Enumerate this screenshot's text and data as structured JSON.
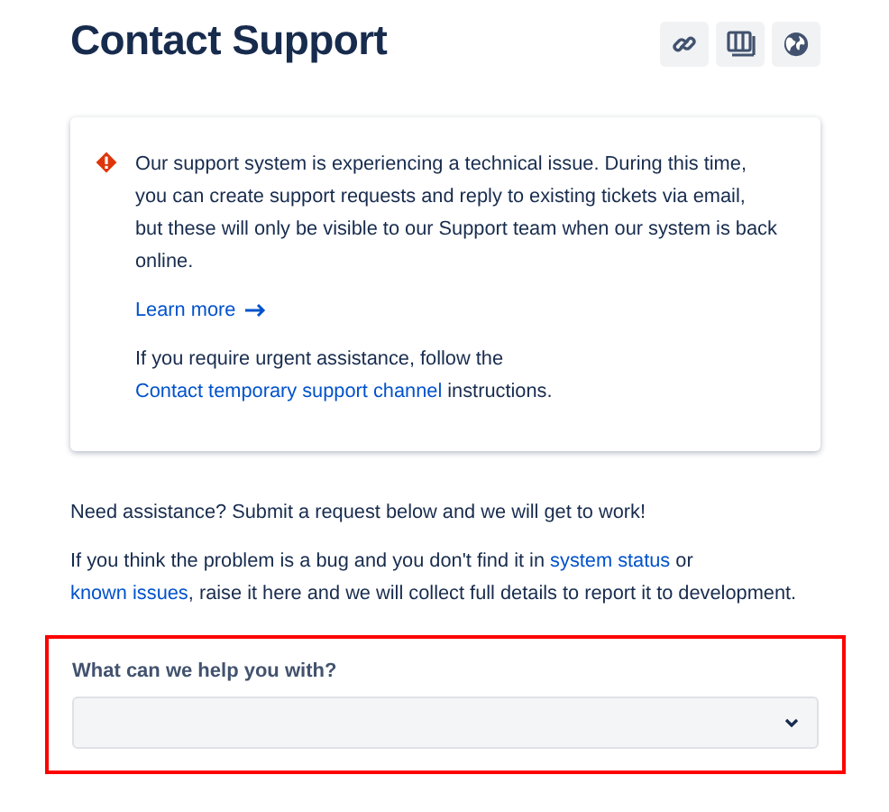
{
  "header": {
    "title": "Contact Support",
    "actions": [
      {
        "kind": "link"
      },
      {
        "kind": "columns"
      },
      {
        "kind": "globe"
      }
    ]
  },
  "notice": {
    "kind": "error",
    "paragraphs": [
      [
        {
          "text": "Our support system is experiencing a technical issue. During this time, you can create support requests and reply to existing tickets via email, but these will only be visible to our Support team when our system is back online."
        }
      ],
      [
        {
          "text": "Learn more",
          "kind": "link",
          "arrow": true
        }
      ],
      [
        {
          "text": "If you require urgent assistance, follow the "
        },
        {
          "text": "Contact temporary support channel",
          "kind": "link"
        },
        {
          "text": " instructions."
        }
      ]
    ]
  },
  "intro": [
    [
      {
        "text": "Need assistance? Submit a request below and we will get to work!"
      }
    ],
    [
      {
        "text": "If you think the problem is a bug and you don't find it in "
      },
      {
        "text": "system status",
        "kind": "link"
      },
      {
        "text": " or "
      },
      {
        "text": "known issues",
        "kind": "link"
      },
      {
        "text": ", raise it here and we will collect full details to report it to development."
      }
    ]
  ],
  "form_field": {
    "label": "What can we help you with?",
    "highlighted": true
  }
}
